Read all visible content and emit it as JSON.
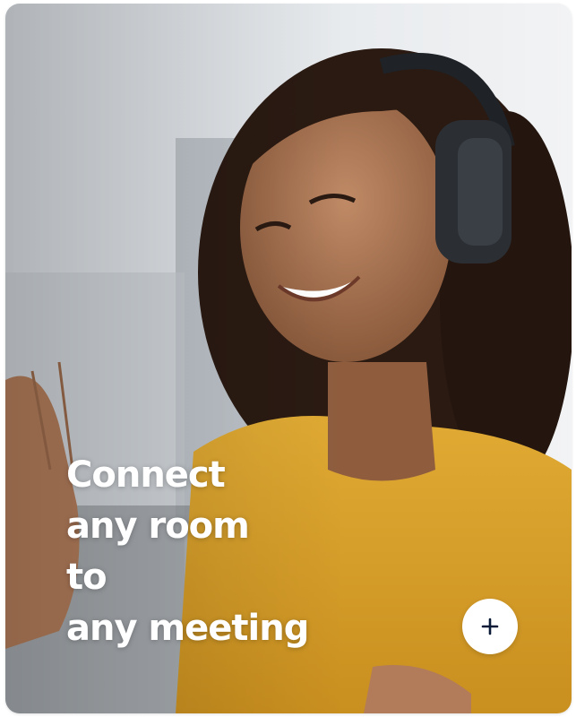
{
  "card": {
    "headline_lines": [
      "Connect",
      "any room",
      "to",
      "any meeting"
    ]
  },
  "icons": {
    "expand": "plus-icon"
  },
  "colors": {
    "shirt": "#d9a22e",
    "headline_text": "#ffffff",
    "button_bg": "#ffffff",
    "button_icon": "#0b1a36"
  }
}
